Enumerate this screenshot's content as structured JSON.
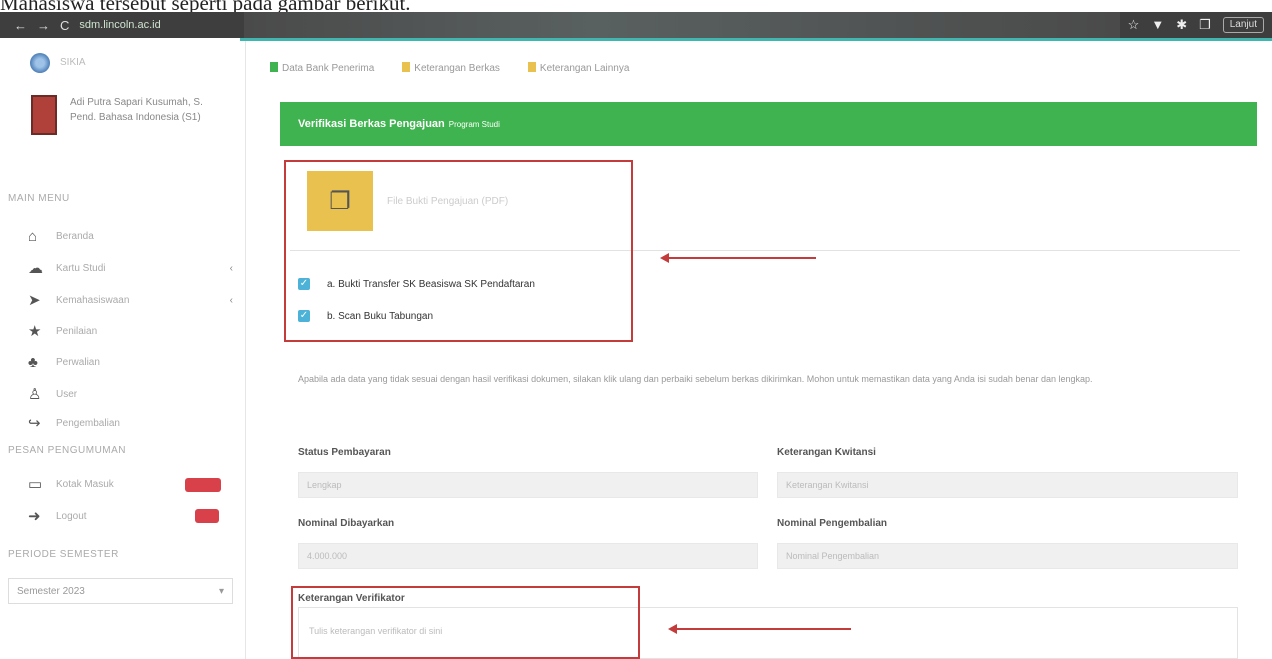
{
  "caption": "Mahasiswa tersebut seperti pada gambar berikut.",
  "browser": {
    "url": "sdm.lincoln.ac.id",
    "nav_icons": [
      "←",
      "→",
      "C"
    ],
    "menu_button": "Lanjut"
  },
  "sidebar": {
    "logo_text": "SIKIA",
    "profile_name": "Adi Putra Sapari Kusumah, S.",
    "profile_sub": "Pend. Bahasa Indonesia (S1)",
    "section_main": "MAIN MENU",
    "items": [
      {
        "label": "Beranda",
        "icon": "home-icon"
      },
      {
        "label": "Kartu Studi",
        "icon": "cloud-icon",
        "chevron": "‹"
      },
      {
        "label": "Kemahasiswaan",
        "icon": "send-icon",
        "chevron": "‹"
      },
      {
        "label": "Penilaian",
        "icon": "star-icon"
      },
      {
        "label": "Perwalian",
        "icon": "users-icon"
      },
      {
        "label": "User",
        "icon": "user-icon"
      },
      {
        "label": "Pengembalian",
        "icon": "share-icon"
      }
    ],
    "section_msg": "PESAN PENGUMUMAN",
    "msg_items": [
      {
        "label": "Kotak Masuk",
        "icon": "inbox-icon"
      },
      {
        "label": "Logout",
        "icon": "logout-icon"
      }
    ],
    "section_semester": "PERIODE SEMESTER",
    "semester_select": "Semester 2023"
  },
  "tabs": [
    {
      "label": "Data Bank Penerima",
      "color": "#3fb34f"
    },
    {
      "label": "Keterangan Berkas",
      "color": "#e8c14f"
    },
    {
      "label": "Keterangan Lainnya",
      "color": "#e8c14f"
    }
  ],
  "panel": {
    "title": "Verifikasi Berkas Pengajuan",
    "subtitle": "Program Studi"
  },
  "document": {
    "info": "File Bukti Pengajuan (PDF)"
  },
  "checks": [
    {
      "label": "a. Bukti Transfer SK Beasiswa SK Pendaftaran"
    },
    {
      "label": "b. Scan Buku Tabungan"
    }
  ],
  "notice": "Apabila ada data yang tidak sesuai dengan hasil verifikasi dokumen, silakan klik ulang dan perbaiki sebelum berkas dikirimkan. Mohon untuk memastikan data yang Anda isi sudah benar dan lengkap.",
  "form": {
    "status_label": "Status Pembayaran",
    "status_value": "Lengkap",
    "ket_kwitansi_label": "Keterangan Kwitansi",
    "ket_kwitansi_value": "Keterangan Kwitansi",
    "nominal_label": "Nominal Dibayarkan",
    "nominal_value": "4.000.000",
    "nominal_pengembalian_label": "Nominal Pengembalian",
    "nominal_pengembalian_value": "Nominal Pengembalian",
    "ket_verifikator_label": "Keterangan Verifikator",
    "ket_verifikator_placeholder": "Tulis keterangan verifikator di sini"
  },
  "colors": {
    "accent_green": "#3fb34f",
    "highlight_red": "#c33b3b",
    "badge_red": "#d8404a",
    "doc_yellow": "#e8c14f",
    "teal": "#3fb6b0"
  }
}
